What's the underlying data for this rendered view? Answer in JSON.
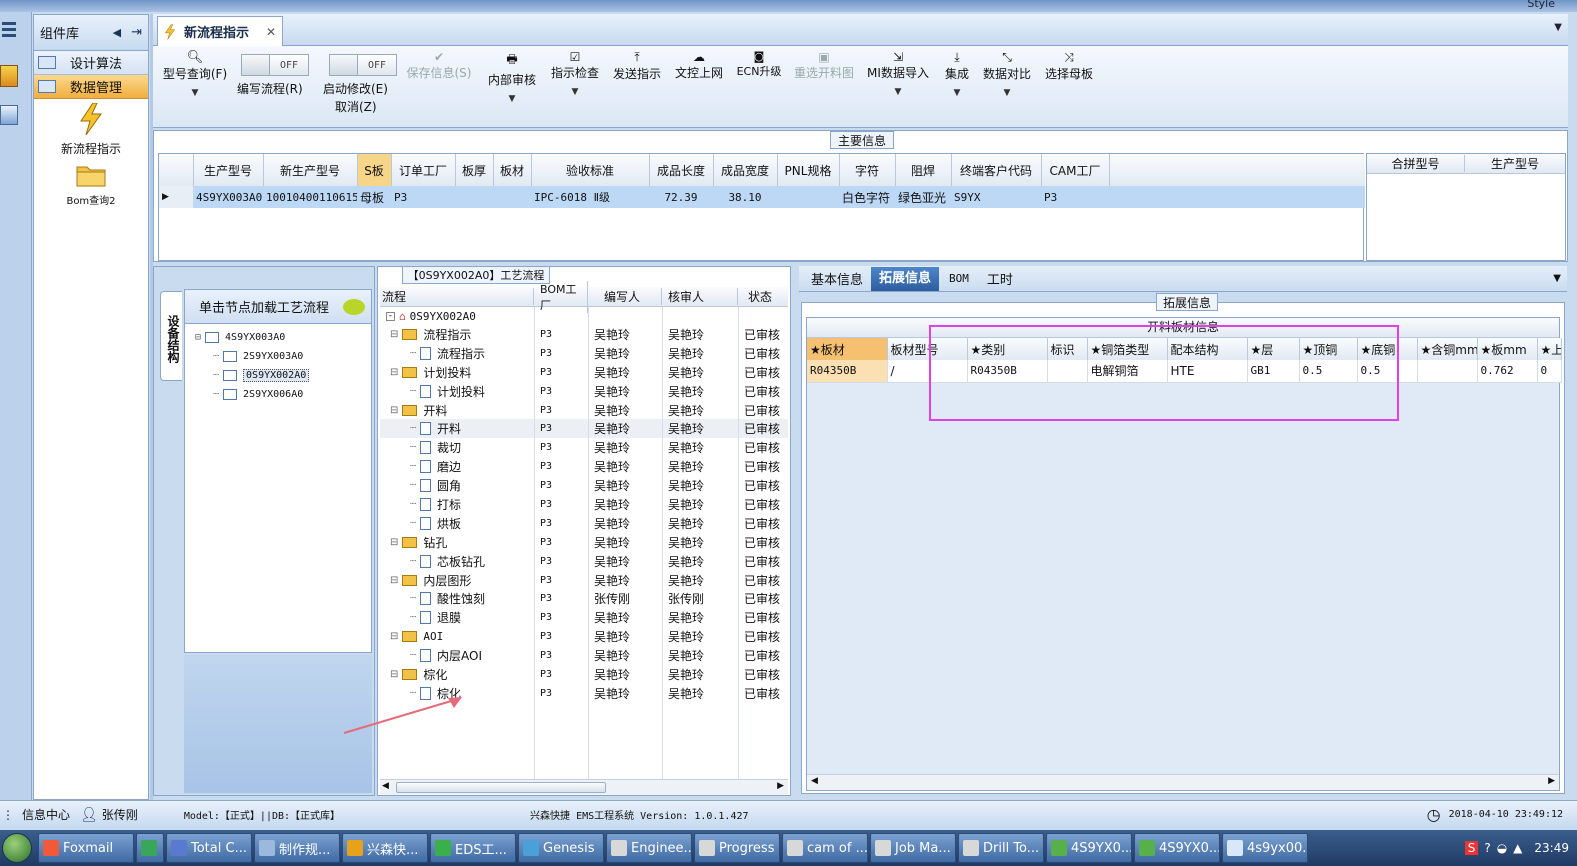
{
  "window": {
    "top_right": "Style"
  },
  "left_panel": {
    "title": "组件库",
    "items": [
      {
        "label": "设计算法"
      },
      {
        "label": "数据管理"
      }
    ],
    "modules": [
      {
        "label": "新流程指示"
      },
      {
        "label": "Bom查询2"
      }
    ]
  },
  "tab": {
    "label": "新流程指示"
  },
  "toolbar": {
    "buttons": [
      {
        "label": "型号查询(F)",
        "icon": "search-icon",
        "dropdown": true
      },
      {
        "label": "保存信息(S)",
        "icon": "check-icon",
        "disabled": true
      },
      {
        "label": "内部审核",
        "icon": "printer-icon",
        "dropdown": true
      },
      {
        "label": "指示检查",
        "icon": "check-box-icon",
        "dropdown": true
      },
      {
        "label": "发送指示",
        "icon": "upload-icon"
      },
      {
        "label": "文控上网",
        "icon": "cloud-upload-icon"
      },
      {
        "label": "ECN升级",
        "icon": "binoculars-icon"
      },
      {
        "label": "重选开料图",
        "icon": "image-icon",
        "disabled": true
      },
      {
        "label": "MI数据导入",
        "icon": "import-icon",
        "dropdown": true
      },
      {
        "label": "集成",
        "icon": "download-icon",
        "dropdown": true
      },
      {
        "label": "数据对比",
        "icon": "compare-icon",
        "dropdown": true
      },
      {
        "label": "选择母板",
        "icon": "shuffle-icon"
      }
    ],
    "toggle1": {
      "state": "OFF",
      "label": "编写流程(R)"
    },
    "toggle2": {
      "state": "OFF",
      "label": "启动修改(E)",
      "sub": "取消(Z)"
    }
  },
  "main_info": {
    "title": "主要信息",
    "columns": [
      "生产型号",
      "新生产型号",
      "S板",
      "订单工厂",
      "板厚",
      "板材",
      "验收标准",
      "成品长度",
      "成品宽度",
      "PNL规格",
      "字符",
      "阻焊",
      "终端客户代码",
      "CAM工厂"
    ],
    "row": [
      "4S9YX003A0",
      "10010400110615",
      "母板",
      "P3",
      "",
      "",
      "IPC-6018 Ⅱ级",
      "72.39",
      "38.10",
      "",
      "白色字符",
      "绿色亚光",
      "S9YX",
      "P3"
    ],
    "side_columns": [
      "合拼型号",
      "生产型号"
    ]
  },
  "struct_panel": {
    "vtab": "设备结构",
    "header": "单击节点加载工艺流程",
    "tree": [
      {
        "label": "4S9YX003A0",
        "level": 0
      },
      {
        "label": "2S9YX003A0",
        "level": 1
      },
      {
        "label": "0S9YX002A0",
        "level": 1,
        "selected": true
      },
      {
        "label": "2S9YX006A0",
        "level": 1
      }
    ]
  },
  "process": {
    "title": "【0S9YX002A0】工艺流程",
    "columns": [
      "流程",
      "BOM工厂",
      "编写人",
      "核审人",
      "状态"
    ],
    "root": "0S9YX002A0",
    "rows": [
      {
        "name": "流程指示",
        "level": 1,
        "folder": true,
        "f": "P3",
        "w": "吴艳玲",
        "r": "吴艳玲",
        "s": "已审核"
      },
      {
        "name": "流程指示",
        "level": 2,
        "f": "P3",
        "w": "吴艳玲",
        "r": "吴艳玲",
        "s": "已审核"
      },
      {
        "name": "计划投料",
        "level": 1,
        "folder": true,
        "f": "P3",
        "w": "吴艳玲",
        "r": "吴艳玲",
        "s": "已审核"
      },
      {
        "name": "计划投料",
        "level": 2,
        "f": "P3",
        "w": "吴艳玲",
        "r": "吴艳玲",
        "s": "已审核"
      },
      {
        "name": "开料",
        "level": 1,
        "folder": true,
        "f": "P3",
        "w": "吴艳玲",
        "r": "吴艳玲",
        "s": "已审核"
      },
      {
        "name": "开料",
        "level": 2,
        "f": "P3",
        "w": "吴艳玲",
        "r": "吴艳玲",
        "s": "已审核",
        "hl": true
      },
      {
        "name": "裁切",
        "level": 2,
        "f": "P3",
        "w": "吴艳玲",
        "r": "吴艳玲",
        "s": "已审核"
      },
      {
        "name": "磨边",
        "level": 2,
        "f": "P3",
        "w": "吴艳玲",
        "r": "吴艳玲",
        "s": "已审核"
      },
      {
        "name": "圆角",
        "level": 2,
        "f": "P3",
        "w": "吴艳玲",
        "r": "吴艳玲",
        "s": "已审核"
      },
      {
        "name": "打标",
        "level": 2,
        "f": "P3",
        "w": "吴艳玲",
        "r": "吴艳玲",
        "s": "已审核"
      },
      {
        "name": "烘板",
        "level": 2,
        "f": "P3",
        "w": "吴艳玲",
        "r": "吴艳玲",
        "s": "已审核"
      },
      {
        "name": "钻孔",
        "level": 1,
        "folder": true,
        "f": "P3",
        "w": "吴艳玲",
        "r": "吴艳玲",
        "s": "已审核"
      },
      {
        "name": "芯板钻孔",
        "level": 2,
        "f": "P3",
        "w": "吴艳玲",
        "r": "吴艳玲",
        "s": "已审核"
      },
      {
        "name": "内层图形",
        "level": 1,
        "folder": true,
        "f": "P3",
        "w": "吴艳玲",
        "r": "吴艳玲",
        "s": "已审核"
      },
      {
        "name": "酸性蚀刻",
        "level": 2,
        "f": "P3",
        "w": "张传刚",
        "r": "张传刚",
        "s": "已审核"
      },
      {
        "name": "退膜",
        "level": 2,
        "f": "P3",
        "w": "吴艳玲",
        "r": "吴艳玲",
        "s": "已审核"
      },
      {
        "name": "AOI",
        "level": 1,
        "folder": true,
        "f": "P3",
        "w": "吴艳玲",
        "r": "吴艳玲",
        "s": "已审核"
      },
      {
        "name": "内层AOI",
        "level": 2,
        "f": "P3",
        "w": "吴艳玲",
        "r": "吴艳玲",
        "s": "已审核"
      },
      {
        "name": "棕化",
        "level": 1,
        "folder": true,
        "f": "P3",
        "w": "吴艳玲",
        "r": "吴艳玲",
        "s": "已审核"
      },
      {
        "name": "棕化",
        "level": 2,
        "f": "P3",
        "w": "吴艳玲",
        "r": "吴艳玲",
        "s": "已审核"
      }
    ]
  },
  "right_panel": {
    "tabs": [
      "基本信息",
      "拓展信息",
      "BOM",
      "工时"
    ],
    "group_title": "拓展信息",
    "grid_title": "开料板材信息",
    "columns": [
      "★板材",
      "板材型号",
      "★类别",
      "标识",
      "★铜箔类型",
      "配本结构",
      "★层",
      "★顶铜",
      "★底铜",
      "★含铜mm",
      "★板mm",
      "★上"
    ],
    "row": [
      "R04350B",
      "/",
      "R04350B",
      "",
      "电解铜箔",
      "HTE",
      "GB1",
      "0.5",
      "0.5",
      "",
      "0.762",
      "0"
    ]
  },
  "status": {
    "info_center": "信息中心",
    "user": "张传刚",
    "model": "Model:【正式】||DB:【正式库】",
    "app": "兴森快捷 EMS工程系统 Version: 1.0.1.427",
    "datetime": "2018-04-10 23:49:12"
  },
  "taskbar": {
    "items": [
      "Foxmail",
      "",
      "Total C...",
      "制作规...",
      "兴森快...",
      "EDS工...",
      "Genesis",
      "Enginee...",
      "Progress",
      "cam of ...",
      "Job Ma...",
      "Drill To...",
      "4S9YX0...",
      "4S9YX0...",
      "4s9yx00..."
    ],
    "clock": "23:49"
  }
}
